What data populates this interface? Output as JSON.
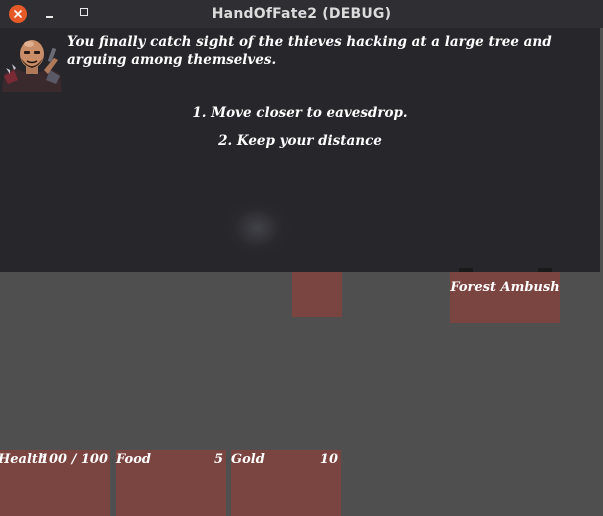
{
  "window": {
    "title": "HandOfFate2 (DEBUG)"
  },
  "event": {
    "text": "You finally catch sight of the thieves hacking at a large tree and arguing among themselves.",
    "choices": [
      {
        "label": "1. Move closer to eavesdrop."
      },
      {
        "label": "2. Keep your distance"
      }
    ]
  },
  "board": {
    "encounter_card": {
      "label": "Forest Ambush"
    }
  },
  "stats": {
    "health": {
      "label": "Health",
      "value": "100 / 100"
    },
    "food": {
      "label": "Food",
      "value": "5"
    },
    "gold": {
      "label": "Gold",
      "value": "10"
    }
  },
  "colors": {
    "panel": "#27272b",
    "board": "#4f4f4f",
    "card": "#7a4541",
    "close_button": "#e65a2a"
  },
  "icons": {
    "close": "close-icon",
    "minimize": "minimize-icon",
    "maximize": "maximize-icon",
    "portrait": "dealer-portrait-icon"
  }
}
